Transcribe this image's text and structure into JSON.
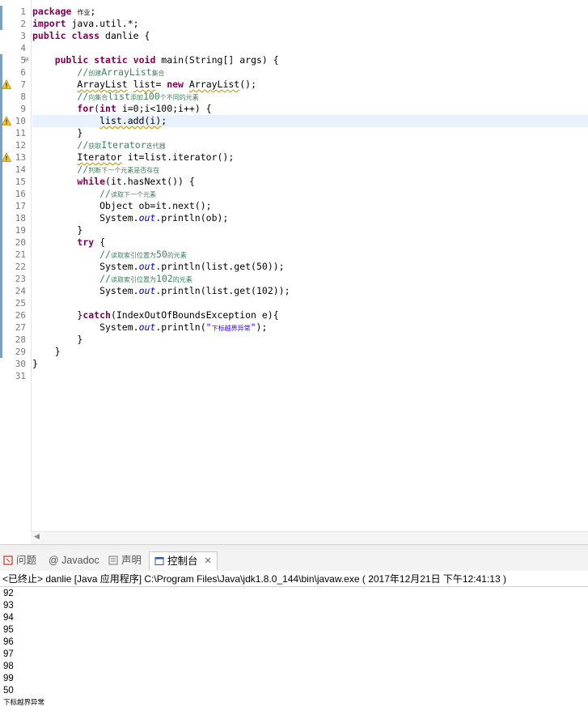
{
  "editor": {
    "line_numbers": [
      "1",
      "2",
      "3",
      "4",
      "5",
      "6",
      "7",
      "8",
      "9",
      "10",
      "11",
      "12",
      "13",
      "14",
      "15",
      "16",
      "17",
      "18",
      "19",
      "20",
      "21",
      "22",
      "23",
      "24",
      "25",
      "26",
      "27",
      "28",
      "29",
      "30",
      "31"
    ],
    "lines": [
      [
        {
          "t": "package",
          "c": "kw"
        },
        {
          "t": " "
        },
        {
          "t": "作业",
          "c": "cjk"
        },
        {
          "t": ";"
        }
      ],
      [
        {
          "t": "import",
          "c": "kw"
        },
        {
          "t": " java.util.*;"
        }
      ],
      [
        {
          "t": "public",
          "c": "kw"
        },
        {
          "t": " "
        },
        {
          "t": "class",
          "c": "kw"
        },
        {
          "t": " danlie {"
        }
      ],
      [],
      [
        {
          "t": "    "
        },
        {
          "t": "public",
          "c": "kw"
        },
        {
          "t": " "
        },
        {
          "t": "static",
          "c": "kw"
        },
        {
          "t": " "
        },
        {
          "t": "void",
          "c": "kw"
        },
        {
          "t": " main(String[] args) {"
        }
      ],
      [
        {
          "t": "        "
        },
        {
          "t": "//",
          "c": "cm"
        },
        {
          "t": "创建",
          "c": "cm cjk"
        },
        {
          "t": "ArrayList",
          "c": "cm"
        },
        {
          "t": "集合",
          "c": "cm cjk"
        }
      ],
      [
        {
          "t": "        "
        },
        {
          "t": "ArrayList",
          "c": "uline"
        },
        {
          "t": " "
        },
        {
          "t": "list",
          "c": "uline"
        },
        {
          "t": "= "
        },
        {
          "t": "new",
          "c": "kw"
        },
        {
          "t": " "
        },
        {
          "t": "ArrayList",
          "c": "uline"
        },
        {
          "t": "();"
        }
      ],
      [
        {
          "t": "        "
        },
        {
          "t": "//",
          "c": "cm"
        },
        {
          "t": "向集合",
          "c": "cm cjk"
        },
        {
          "t": "list",
          "c": "cm"
        },
        {
          "t": "添加",
          "c": "cm cjk"
        },
        {
          "t": "100",
          "c": "cm"
        },
        {
          "t": "个不同的元素",
          "c": "cm cjk"
        }
      ],
      [
        {
          "t": "        "
        },
        {
          "t": "for",
          "c": "kw"
        },
        {
          "t": "("
        },
        {
          "t": "int",
          "c": "kw"
        },
        {
          "t": " i=0;i<100;i++) {"
        }
      ],
      [
        {
          "t": "            "
        },
        {
          "t": "list.add(i)",
          "c": "uline"
        },
        {
          "t": ";"
        }
      ],
      [
        {
          "t": "        }"
        }
      ],
      [
        {
          "t": "        "
        },
        {
          "t": "//",
          "c": "cm"
        },
        {
          "t": "获取",
          "c": "cm cjk"
        },
        {
          "t": "Iterator",
          "c": "cm"
        },
        {
          "t": "迭代器",
          "c": "cm cjk"
        }
      ],
      [
        {
          "t": "        "
        },
        {
          "t": "Iterator",
          "c": "uline"
        },
        {
          "t": " it=list.iterator();"
        }
      ],
      [
        {
          "t": "        "
        },
        {
          "t": "//",
          "c": "cm"
        },
        {
          "t": "判断下一个元素是否存在",
          "c": "cm cjk"
        }
      ],
      [
        {
          "t": "        "
        },
        {
          "t": "while",
          "c": "kw"
        },
        {
          "t": "(it.hasNext()) {"
        }
      ],
      [
        {
          "t": "            "
        },
        {
          "t": "//",
          "c": "cm"
        },
        {
          "t": "读取下一个元素",
          "c": "cm cjk"
        }
      ],
      [
        {
          "t": "            Object ob=it.next();"
        }
      ],
      [
        {
          "t": "            System."
        },
        {
          "t": "out",
          "c": "fld"
        },
        {
          "t": ".println(ob);"
        }
      ],
      [
        {
          "t": "        }"
        }
      ],
      [
        {
          "t": "        "
        },
        {
          "t": "try",
          "c": "kw"
        },
        {
          "t": " {"
        }
      ],
      [
        {
          "t": "            "
        },
        {
          "t": "//",
          "c": "cm"
        },
        {
          "t": "读取索引位置为",
          "c": "cm cjk"
        },
        {
          "t": "50",
          "c": "cm"
        },
        {
          "t": "的元素",
          "c": "cm cjk"
        }
      ],
      [
        {
          "t": "            System."
        },
        {
          "t": "out",
          "c": "fld"
        },
        {
          "t": ".println(list.get(50));"
        }
      ],
      [
        {
          "t": "            "
        },
        {
          "t": "//",
          "c": "cm"
        },
        {
          "t": "读取索引位置为",
          "c": "cm cjk"
        },
        {
          "t": "102",
          "c": "cm"
        },
        {
          "t": "的元素",
          "c": "cm cjk"
        }
      ],
      [
        {
          "t": "            System."
        },
        {
          "t": "out",
          "c": "fld"
        },
        {
          "t": ".println(list.get(102));"
        }
      ],
      [],
      [
        {
          "t": "        }"
        },
        {
          "t": "catch",
          "c": "kw"
        },
        {
          "t": "(IndexOutOfBoundsException e){"
        }
      ],
      [
        {
          "t": "            System."
        },
        {
          "t": "out",
          "c": "fld"
        },
        {
          "t": ".println("
        },
        {
          "t": "\"",
          "c": "str"
        },
        {
          "t": "下标越界异常",
          "c": "str cjk"
        },
        {
          "t": "\"",
          "c": "str"
        },
        {
          "t": ");"
        }
      ],
      [
        {
          "t": "        }"
        }
      ],
      [
        {
          "t": "    }"
        }
      ],
      [
        {
          "t": "}"
        }
      ],
      []
    ]
  },
  "tabs": [
    {
      "label": "问题",
      "icon": "problems-icon"
    },
    {
      "label": "@ Javadoc",
      "icon": "javadoc-icon"
    },
    {
      "label": "声明",
      "icon": "declaration-icon"
    },
    {
      "label": "控制台",
      "icon": "console-icon",
      "active": true
    }
  ],
  "console": {
    "header": "<已终止> danlie [Java 应用程序] C:\\Program Files\\Java\\jdk1.8.0_144\\bin\\javaw.exe ( 2017年12月21日 下午12:41:13 )",
    "output": [
      "92",
      "93",
      "94",
      "95",
      "96",
      "97",
      "98",
      "99",
      "50",
      "下标越界异常"
    ]
  },
  "colors": {
    "keyword": "#7f0055",
    "comment": "#3f7f5f",
    "string": "#2a00ff",
    "field": "#0000c0",
    "current_line": "#e8f2fe"
  }
}
